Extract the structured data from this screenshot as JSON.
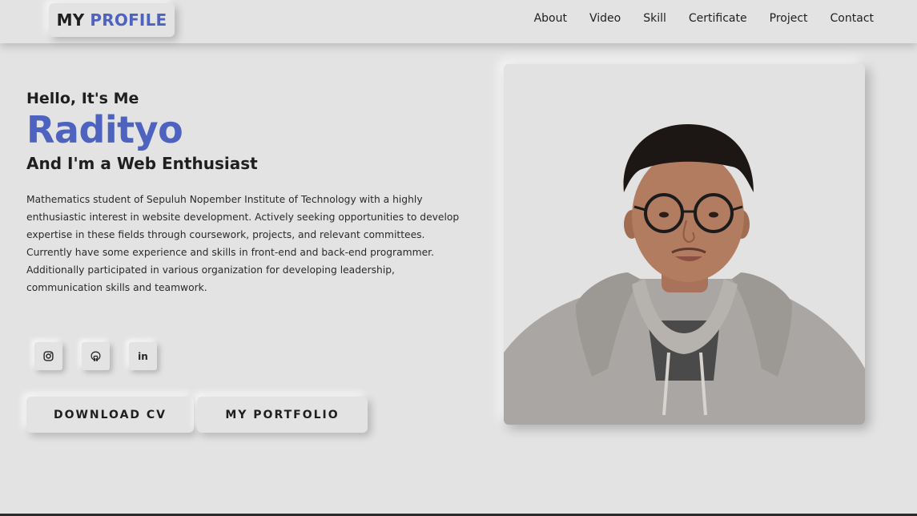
{
  "logo": {
    "part1": "MY",
    "part2": "PROFILE"
  },
  "nav": {
    "items": [
      "About",
      "Video",
      "Skill",
      "Certificate",
      "Project",
      "Contact"
    ]
  },
  "hero": {
    "greeting": "Hello, It's Me",
    "name": "Radityo",
    "role": "And I'm a Web Enthusiast",
    "bio": "Mathematics student of Sepuluh Nopember Institute of Technology with a highly enthusiastic interest in website development. Actively seeking opportunities to develop expertise in these fields through coursework, projects, and relevant committees. Currently have some experience and skills in front-end and back-end programmer. Additionally participated in various organization for developing leadership, communication skills and teamwork."
  },
  "socials": [
    {
      "icon": "instagram-icon"
    },
    {
      "icon": "github-icon"
    },
    {
      "icon": "linkedin-icon",
      "label": "in"
    }
  ],
  "buttons": {
    "download_cv": "DOWNLOAD CV",
    "portfolio": "MY PORTFOLIO"
  },
  "colors": {
    "accent": "#4e63bf",
    "background": "#e3e3e3",
    "text": "#1f1f1f"
  }
}
